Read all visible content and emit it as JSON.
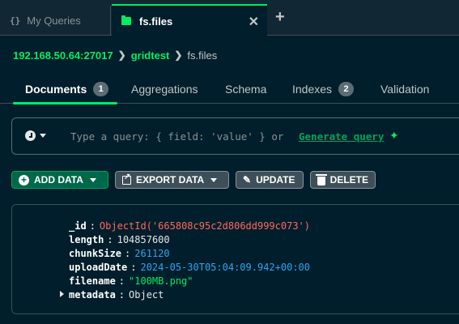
{
  "tabs": [
    {
      "icon": "braces-icon",
      "label": "My Queries"
    },
    {
      "icon": "folder-icon",
      "label": "fs.files",
      "active": true
    }
  ],
  "tab_close_glyph": "✕",
  "tab_add_glyph": "+",
  "breadcrumb": {
    "host": "192.168.50.64:27017",
    "database": "gridtest",
    "collection": "fs.files"
  },
  "subtabs": [
    {
      "label": "Documents",
      "count": "1",
      "active": true
    },
    {
      "label": "Aggregations"
    },
    {
      "label": "Schema"
    },
    {
      "label": "Indexes",
      "count": "2"
    },
    {
      "label": "Validation"
    }
  ],
  "query": {
    "placeholder": "Type a query: { field: 'value' } or",
    "generate_label": "Generate query",
    "sparkle_glyph": "✦"
  },
  "actions": {
    "add_data": "ADD DATA",
    "export_data": "EXPORT DATA",
    "update": "UPDATE",
    "delete": "DELETE"
  },
  "document": [
    {
      "key": "_id",
      "value": "ObjectId('665808c95c2d806dd999c073')",
      "kind": "oid"
    },
    {
      "key": "length",
      "value": "104857600",
      "kind": "num"
    },
    {
      "key": "chunkSize",
      "value": "261120",
      "kind": "blue"
    },
    {
      "key": "uploadDate",
      "value": "2024-05-30T05:04:09.942+00:00",
      "kind": "blue"
    },
    {
      "key": "filename",
      "value": "\"100MB.png\"",
      "kind": "str"
    },
    {
      "key": "metadata",
      "value": "Object",
      "kind": "obj",
      "expandable": true
    }
  ],
  "colors": {
    "background": "#001e2b",
    "accent": "#00ed64",
    "objectid": "#ff6960",
    "number": "#2ba6f2"
  }
}
